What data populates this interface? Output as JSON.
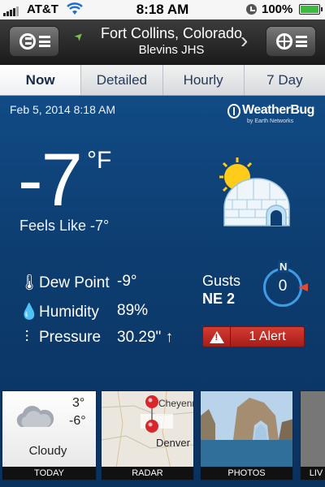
{
  "status_bar": {
    "carrier": "AT&T",
    "time": "8:18 AM",
    "battery_percent": "100%",
    "signal_bars": 4,
    "battery_level": 1.0
  },
  "header": {
    "location_name": "Fort Collins, Colorado",
    "station": "Blevins JHS",
    "left_button_icon": "weatherbug-menu-icon",
    "right_button_icon": "location-target-menu-icon"
  },
  "tabs": [
    {
      "label": "Now",
      "active": true
    },
    {
      "label": "Detailed",
      "active": false
    },
    {
      "label": "Hourly",
      "active": false
    },
    {
      "label": "7 Day",
      "active": false
    }
  ],
  "current": {
    "date_time": "Feb 5, 2014 8:18 AM",
    "brand_name": "WeatherBug",
    "brand_sub": "by Earth Networks",
    "temperature": "-7",
    "unit": "°F",
    "feels_like": "Feels Like -7°",
    "condition_icon": "sun-igloo-icon"
  },
  "metrics": [
    {
      "label": "Dew Point",
      "value": "-9°",
      "icon": "thermometer-icon"
    },
    {
      "label": "Humidity",
      "value": "89%",
      "icon": "droplets-icon"
    },
    {
      "label": "Pressure",
      "value": "30.29\" ↑",
      "icon": "pressure-icon"
    }
  ],
  "wind": {
    "gusts_label": "Gusts",
    "gusts_value": "NE 2",
    "compass_north": "N",
    "speed": "0"
  },
  "alert": {
    "label": "1 Alert"
  },
  "cards": {
    "today": {
      "hi": "3°",
      "lo": "-6°",
      "condition": "Cloudy",
      "caption": "TODAY"
    },
    "radar": {
      "caption": "RADAR",
      "city_1": "Cheyenne",
      "city_2": "Denver"
    },
    "photos": {
      "caption": "PHOTOS"
    },
    "live": {
      "caption": "LIV"
    }
  },
  "colors": {
    "panel_blue": "#0d3d70",
    "alert_red": "#c12d26",
    "compass_ring": "#3f9be4"
  }
}
